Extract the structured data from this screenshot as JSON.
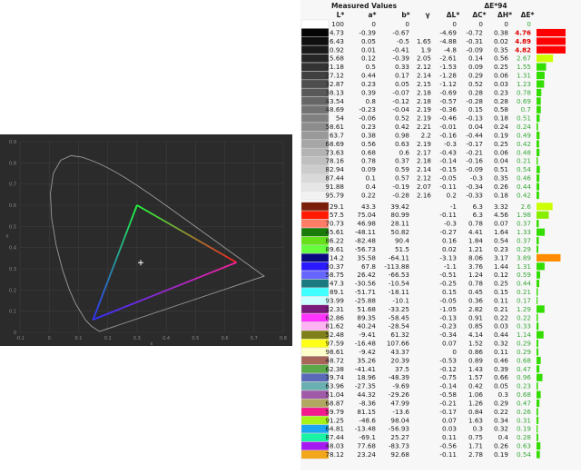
{
  "chart_data": [
    {
      "type": "scatter",
      "title": "",
      "xlabel": "x",
      "ylabel": "y",
      "xlim": [
        -0.1,
        0.8
      ],
      "ylim": [
        0,
        0.9
      ],
      "x_ticks": [
        "-0.1",
        "0",
        "0.1",
        "0.2",
        "0.3",
        "0.4",
        "0.5",
        "0.6",
        "0.7",
        "0.8"
      ],
      "y_ticks": [
        "0",
        "0.1",
        "0.2",
        "0.3",
        "0.4",
        "0.5",
        "0.6",
        "0.7",
        "0.8",
        "0.9"
      ],
      "grid": true,
      "measured_gamut": {
        "red": [
          0.64,
          0.33
        ],
        "green": [
          0.3,
          0.6
        ],
        "blue": [
          0.15,
          0.06
        ]
      },
      "white_point": [
        0.3127,
        0.329
      ],
      "colors": {
        "red": "#ff2020",
        "green": "#20ff40",
        "blue": "#3030ff",
        "background": "#2b2b2b",
        "locus": "#9a9a9a"
      }
    },
    {
      "type": "table",
      "group_header_measured": "Measured Values",
      "group_header_de": "ΔE*94",
      "columns": [
        "L*",
        "a*",
        "b*",
        "γ",
        "ΔL*",
        "ΔC*",
        "ΔH*",
        "ΔE*"
      ],
      "rows": [
        {
          "swatch": "#ffffff",
          "L": "100",
          "a": "0",
          "b": "0",
          "g": "",
          "dL": "0",
          "dC": "0",
          "dH": "0",
          "dE": "0",
          "bar": "#ffffff"
        },
        {
          "swatch": "#050505",
          "L": "4.73",
          "a": "-0.39",
          "b": "-0.67",
          "g": "",
          "dL": "-4.69",
          "dC": "-0.72",
          "dH": "0.38",
          "dE": "4.76",
          "bar": "#ff0000",
          "hi": true
        },
        {
          "swatch": "#0f0f0f",
          "L": "6.43",
          "a": "0.05",
          "b": "-0.5",
          "g": "1.65",
          "dL": "-4.88",
          "dC": "-0.31",
          "dH": "0.02",
          "dE": "4.89",
          "bar": "#ff0000",
          "hi": true
        },
        {
          "swatch": "#1a1a1a",
          "L": "10.92",
          "a": "0.01",
          "b": "-0.41",
          "g": "1.9",
          "dL": "-4.8",
          "dC": "-0.09",
          "dH": "0.35",
          "dE": "4.82",
          "bar": "#ff0000",
          "hi": true
        },
        {
          "swatch": "#262626",
          "L": "15.68",
          "a": "0.12",
          "b": "-0.39",
          "g": "2.05",
          "dL": "-2.61",
          "dC": "0.14",
          "dH": "0.56",
          "dE": "2.67",
          "bar": "#ccff00"
        },
        {
          "swatch": "#333333",
          "L": "21.18",
          "a": "0.5",
          "b": "0.33",
          "g": "2.12",
          "dL": "-1.53",
          "dC": "0.09",
          "dH": "0.25",
          "dE": "1.55",
          "bar": "#33dd00"
        },
        {
          "swatch": "#404040",
          "L": "27.12",
          "a": "0.44",
          "b": "0.17",
          "g": "2.14",
          "dL": "-1.28",
          "dC": "0.29",
          "dH": "0.06",
          "dE": "1.31",
          "bar": "#33dd00"
        },
        {
          "swatch": "#4d4d4d",
          "L": "32.87",
          "a": "0.23",
          "b": "0.05",
          "g": "2.15",
          "dL": "-1.12",
          "dC": "0.52",
          "dH": "0.03",
          "dE": "1.23",
          "bar": "#33dd00"
        },
        {
          "swatch": "#595959",
          "L": "38.13",
          "a": "0.39",
          "b": "-0.07",
          "g": "2.18",
          "dL": "-0.69",
          "dC": "0.28",
          "dH": "0.23",
          "dE": "0.78",
          "bar": "#33dd00"
        },
        {
          "swatch": "#666666",
          "L": "43.54",
          "a": "0.8",
          "b": "-0.12",
          "g": "2.18",
          "dL": "-0.57",
          "dC": "-0.28",
          "dH": "0.28",
          "dE": "0.69",
          "bar": "#33dd00"
        },
        {
          "swatch": "#737373",
          "L": "48.69",
          "a": "-0.23",
          "b": "-0.04",
          "g": "2.19",
          "dL": "-0.36",
          "dC": "0.15",
          "dH": "0.58",
          "dE": "0.7",
          "bar": "#33dd00"
        },
        {
          "swatch": "#808080",
          "L": "54",
          "a": "-0.06",
          "b": "0.52",
          "g": "2.19",
          "dL": "-0.46",
          "dC": "-0.13",
          "dH": "0.18",
          "dE": "0.51",
          "bar": "#33dd00"
        },
        {
          "swatch": "#8c8c8c",
          "L": "58.61",
          "a": "0.23",
          "b": "0.42",
          "g": "2.21",
          "dL": "-0.01",
          "dC": "0.04",
          "dH": "0.24",
          "dE": "0.24",
          "bar": "#33dd00"
        },
        {
          "swatch": "#999999",
          "L": "63.7",
          "a": "0.38",
          "b": "0.98",
          "g": "2.2",
          "dL": "-0.16",
          "dC": "-0.44",
          "dH": "0.19",
          "dE": "0.49",
          "bar": "#33dd00"
        },
        {
          "swatch": "#a6a6a6",
          "L": "68.69",
          "a": "0.56",
          "b": "0.63",
          "g": "2.19",
          "dL": "-0.3",
          "dC": "-0.17",
          "dH": "0.25",
          "dE": "0.42",
          "bar": "#33dd00"
        },
        {
          "swatch": "#b3b3b3",
          "L": "73.63",
          "a": "0.68",
          "b": "0.6",
          "g": "2.17",
          "dL": "-0.43",
          "dC": "-0.21",
          "dH": "0.06",
          "dE": "0.48",
          "bar": "#33dd00"
        },
        {
          "swatch": "#bfbfbf",
          "L": "78.16",
          "a": "0.78",
          "b": "0.37",
          "g": "2.18",
          "dL": "-0.14",
          "dC": "-0.16",
          "dH": "0.04",
          "dE": "0.21",
          "bar": "#33dd00"
        },
        {
          "swatch": "#cccccc",
          "L": "82.94",
          "a": "0.09",
          "b": "0.59",
          "g": "2.14",
          "dL": "-0.15",
          "dC": "-0.09",
          "dH": "0.51",
          "dE": "0.54",
          "bar": "#33dd00"
        },
        {
          "swatch": "#d9d9d9",
          "L": "87.44",
          "a": "0.1",
          "b": "0.57",
          "g": "2.12",
          "dL": "-0.05",
          "dC": "-0.3",
          "dH": "0.35",
          "dE": "0.46",
          "bar": "#33dd00"
        },
        {
          "swatch": "#e6e6e6",
          "L": "91.88",
          "a": "0.4",
          "b": "-0.19",
          "g": "2.07",
          "dL": "-0.11",
          "dC": "-0.34",
          "dH": "0.26",
          "dE": "0.44",
          "bar": "#33dd00"
        },
        {
          "swatch": "#f2f2f2",
          "L": "95.79",
          "a": "0.22",
          "b": "-0.28",
          "g": "2.16",
          "dL": "0.2",
          "dC": "-0.33",
          "dH": "0.18",
          "dE": "0.42",
          "bar": "#33dd00"
        },
        {
          "swatch": "#7a1f0a",
          "L": "29.1",
          "a": "43.3",
          "b": "39.42",
          "g": "",
          "dL": "-1",
          "dC": "6.3",
          "dH": "3.32",
          "dE": "2.6",
          "bar": "#ccff00",
          "gap": true
        },
        {
          "swatch": "#ff1a00",
          "L": "57.5",
          "a": "75.04",
          "b": "80.99",
          "g": "",
          "dL": "-0.11",
          "dC": "6.3",
          "dH": "4.56",
          "dE": "1.98",
          "bar": "#88ee00"
        },
        {
          "swatch": "#ff7c66",
          "L": "70.73",
          "a": "46.98",
          "b": "28.11",
          "g": "",
          "dL": "-0.3",
          "dC": "0.78",
          "dH": "0.07",
          "dE": "0.37",
          "bar": "#33dd00"
        },
        {
          "swatch": "#1a7a0a",
          "L": "45.61",
          "a": "-48.11",
          "b": "50.82",
          "g": "",
          "dL": "-0.27",
          "dC": "4.41",
          "dH": "1.64",
          "dE": "1.33",
          "bar": "#33dd00"
        },
        {
          "swatch": "#66e01a",
          "L": "86.22",
          "a": "-82.48",
          "b": "90.4",
          "g": "",
          "dL": "0.16",
          "dC": "1.84",
          "dH": "0.54",
          "dE": "0.37",
          "bar": "#33dd00"
        },
        {
          "swatch": "#66ff40",
          "L": "89.61",
          "a": "-56.73",
          "b": "51.5",
          "g": "",
          "dL": "0.02",
          "dC": "1.21",
          "dH": "0.23",
          "dE": "0.29",
          "bar": "#33dd00"
        },
        {
          "swatch": "#0a0a80",
          "L": "14.2",
          "a": "35.58",
          "b": "-64.11",
          "g": "",
          "dL": "-3.13",
          "dC": "8.06",
          "dH": "3.17",
          "dE": "3.89",
          "bar": "#ff8c00"
        },
        {
          "swatch": "#2a1aff",
          "L": "30.37",
          "a": "67.8",
          "b": "-113.88",
          "g": "",
          "dL": "-1.1",
          "dC": "3.76",
          "dH": "1.44",
          "dE": "1.31",
          "bar": "#33dd00"
        },
        {
          "swatch": "#6666ff",
          "L": "58.75",
          "a": "26.42",
          "b": "-66.53",
          "g": "",
          "dL": "-0.51",
          "dC": "1.24",
          "dH": "0.12",
          "dE": "0.59",
          "bar": "#33dd00"
        },
        {
          "swatch": "#1a7a80",
          "L": "47.3",
          "a": "-30.56",
          "b": "-10.54",
          "g": "",
          "dL": "-0.25",
          "dC": "0.78",
          "dH": "0.25",
          "dE": "0.44",
          "bar": "#33dd00"
        },
        {
          "swatch": "#40ffff",
          "L": "89.1",
          "a": "-51.71",
          "b": "-18.11",
          "g": "",
          "dL": "0.15",
          "dC": "0.45",
          "dH": "0.15",
          "dE": "0.21",
          "bar": "#33dd00"
        },
        {
          "swatch": "#ccffff",
          "L": "93.99",
          "a": "-25.88",
          "b": "-10.1",
          "g": "",
          "dL": "-0.05",
          "dC": "0.36",
          "dH": "0.11",
          "dE": "0.17",
          "bar": "#33dd00"
        },
        {
          "swatch": "#7a1a7a",
          "L": "32.31",
          "a": "51.68",
          "b": "-33.25",
          "g": "",
          "dL": "-1.05",
          "dC": "2.82",
          "dH": "0.21",
          "dE": "1.29",
          "bar": "#33dd00"
        },
        {
          "swatch": "#ff33ff",
          "L": "62.86",
          "a": "89.35",
          "b": "-58.45",
          "g": "",
          "dL": "-0.13",
          "dC": "0.91",
          "dH": "0.22",
          "dE": "0.22",
          "bar": "#33dd00"
        },
        {
          "swatch": "#ffb3f2",
          "L": "81.62",
          "a": "40.24",
          "b": "-28.54",
          "g": "",
          "dL": "-0.23",
          "dC": "0.85",
          "dH": "0.03",
          "dE": "0.33",
          "bar": "#33dd00"
        },
        {
          "swatch": "#80801a",
          "L": "52.48",
          "a": "-9.41",
          "b": "61.32",
          "g": "",
          "dL": "-0.34",
          "dC": "4.14",
          "dH": "0.44",
          "dE": "1.14",
          "bar": "#33dd00"
        },
        {
          "swatch": "#ffff1a",
          "L": "97.59",
          "a": "-16.48",
          "b": "107.66",
          "g": "",
          "dL": "0.07",
          "dC": "1.52",
          "dH": "0.32",
          "dE": "0.29",
          "bar": "#33dd00"
        },
        {
          "swatch": "#ffffcc",
          "L": "98.61",
          "a": "-9.42",
          "b": "43.37",
          "g": "",
          "dL": "0",
          "dC": "0.86",
          "dH": "0.11",
          "dE": "0.29",
          "bar": "#33dd00"
        },
        {
          "swatch": "#a8665a",
          "L": "48.72",
          "a": "35.26",
          "b": "20.39",
          "g": "",
          "dL": "-0.53",
          "dC": "0.89",
          "dH": "0.46",
          "dE": "0.68",
          "bar": "#33dd00"
        },
        {
          "swatch": "#5aa84a",
          "L": "62.38",
          "a": "-41.41",
          "b": "37.5",
          "g": "",
          "dL": "-0.12",
          "dC": "1.43",
          "dH": "0.39",
          "dE": "0.47",
          "bar": "#33dd00"
        },
        {
          "swatch": "#5a6ab8",
          "L": "39.74",
          "a": "18.96",
          "b": "-48.39",
          "g": "",
          "dL": "-0.75",
          "dC": "1.57",
          "dH": "0.66",
          "dE": "0.96",
          "bar": "#33dd00"
        },
        {
          "swatch": "#6ab0b0",
          "L": "63.96",
          "a": "-27.35",
          "b": "-9.69",
          "g": "",
          "dL": "-0.14",
          "dC": "0.42",
          "dH": "0.05",
          "dE": "0.23",
          "bar": "#33dd00"
        },
        {
          "swatch": "#a05aa8",
          "L": "51.04",
          "a": "44.32",
          "b": "-29.26",
          "g": "",
          "dL": "-0.58",
          "dC": "1.06",
          "dH": "0.3",
          "dE": "0.68",
          "bar": "#33dd00"
        },
        {
          "swatch": "#b0a860",
          "L": "68.87",
          "a": "-8.36",
          "b": "47.99",
          "g": "",
          "dL": "-0.21",
          "dC": "1.26",
          "dH": "0.29",
          "dE": "0.47",
          "bar": "#33dd00"
        },
        {
          "swatch": "#f21a8c",
          "L": "59.79",
          "a": "81.15",
          "b": "-13.6",
          "g": "",
          "dL": "-0.17",
          "dC": "0.84",
          "dH": "0.22",
          "dE": "0.26",
          "bar": "#33dd00"
        },
        {
          "swatch": "#a6f21a",
          "L": "91.25",
          "a": "-48.6",
          "b": "98.04",
          "g": "",
          "dL": "0.07",
          "dC": "1.63",
          "dH": "0.34",
          "dE": "0.31",
          "bar": "#33dd00"
        },
        {
          "swatch": "#1aa6f2",
          "L": "64.81",
          "a": "-13.48",
          "b": "-56.93",
          "g": "",
          "dL": "0.03",
          "dC": "0.3",
          "dH": "0.32",
          "dE": "0.19",
          "bar": "#33dd00"
        },
        {
          "swatch": "#1af2a6",
          "L": "87.44",
          "a": "-69.1",
          "b": "25.27",
          "g": "",
          "dL": "0.11",
          "dC": "0.75",
          "dH": "0.4",
          "dE": "0.28",
          "bar": "#33dd00"
        },
        {
          "swatch": "#a61af2",
          "L": "48.03",
          "a": "77.68",
          "b": "-83.73",
          "g": "",
          "dL": "-0.56",
          "dC": "1.71",
          "dH": "0.26",
          "dE": "0.63",
          "bar": "#33dd00"
        },
        {
          "swatch": "#f2a61a",
          "L": "78.12",
          "a": "23.24",
          "b": "92.68",
          "g": "",
          "dL": "-0.11",
          "dC": "2.78",
          "dH": "0.19",
          "dE": "0.54",
          "bar": "#33dd00"
        }
      ]
    }
  ]
}
